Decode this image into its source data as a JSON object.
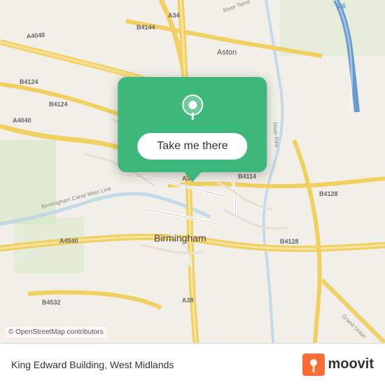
{
  "map": {
    "copyright": "© OpenStreetMap contributors",
    "center_label": "Birmingham"
  },
  "popup": {
    "button_label": "Take me there",
    "pin_icon": "location-pin"
  },
  "bottom_bar": {
    "location_text": "King Edward Building, West Midlands",
    "logo_text": "moovit"
  },
  "colors": {
    "green": "#3db87a",
    "road_yellow": "#f5e07a",
    "road_white": "#ffffff",
    "map_bg": "#f2efe9",
    "water": "#b8d4e8"
  }
}
